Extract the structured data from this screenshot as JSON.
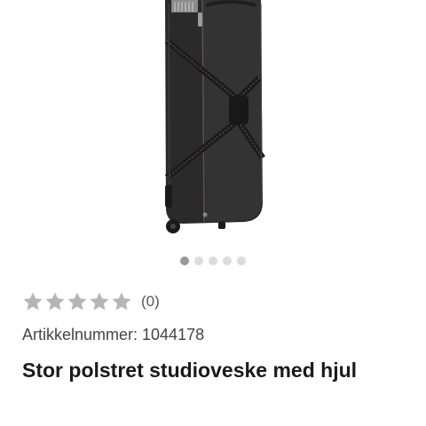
{
  "product": {
    "image": {
      "description_icon": "product-photo-rolling-bag"
    },
    "gallery": {
      "total_images": 5,
      "active_index": 0
    },
    "rating": {
      "stars_total": 5,
      "stars_filled": 0,
      "count_text": "(0)"
    },
    "article_number_text": "Artikkelnummer: 1044178",
    "title": "Stor polstret studioveske med hjul"
  },
  "colors": {
    "star_empty": "#b5b5b5",
    "dot_active": "#9a9a9a",
    "dot_inactive": "#dcdcdc",
    "bag_body": "#2b2b2b"
  }
}
